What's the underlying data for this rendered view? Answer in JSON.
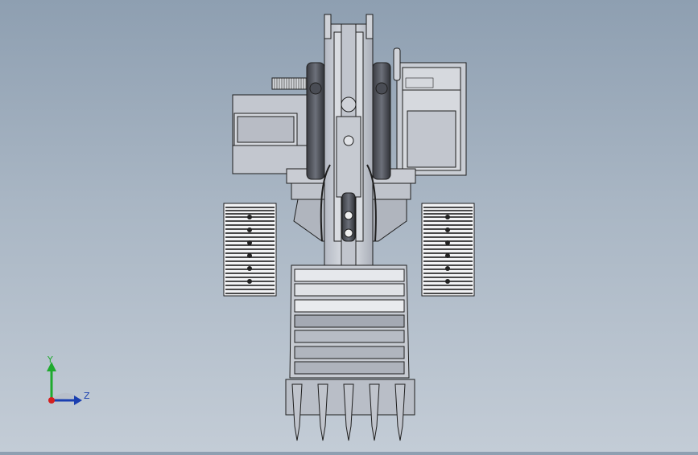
{
  "viewport": {
    "background_top": "#8e9fb1",
    "background_bottom": "#c3ccd6",
    "model_stroke": "#1e1e1e",
    "model_fill": "#c8ccd4"
  },
  "triad": {
    "y_label": "Y",
    "z_label": "Z",
    "y_color": "#1faa2e",
    "z_color": "#1a3fb0",
    "x_color": "#d42020"
  }
}
